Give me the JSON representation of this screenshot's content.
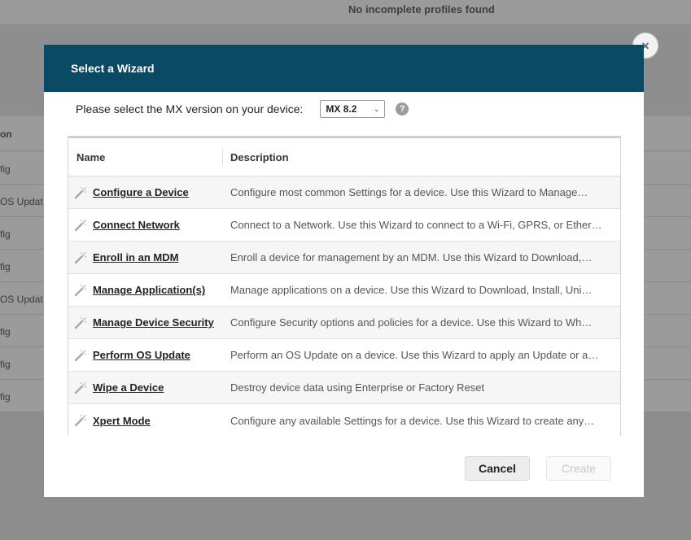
{
  "background": {
    "banner_text": "No incomplete profiles found",
    "column_header": "on",
    "rows": [
      "fig",
      "OS Updat",
      "fig",
      "fig",
      "OS Updat",
      "fig",
      "fig",
      "fig"
    ]
  },
  "dialog": {
    "title": "Select a Wizard",
    "close_symbol": "×",
    "mx_label": "Please select the MX version on your device:",
    "mx_selected": "MX 8.2",
    "help_symbol": "?",
    "columns": {
      "name": "Name",
      "description": "Description"
    },
    "wizards": [
      {
        "name": "Configure a Device",
        "description": "Configure most common Settings for a device. Use this Wizard to Manage…"
      },
      {
        "name": "Connect Network",
        "description": "Connect to a Network. Use this Wizard to connect to a Wi-Fi, GPRS, or Ether…"
      },
      {
        "name": "Enroll in an MDM",
        "description": "Enroll a device for management by an MDM.  Use this Wizard to Download,…"
      },
      {
        "name": "Manage Application(s)",
        "description": "Manage applications on a device.  Use this Wizard to Download, Install, Uni…"
      },
      {
        "name": "Manage Device Security",
        "description": "Configure Security options and policies for a device.  Use this Wizard to Wh…"
      },
      {
        "name": "Perform OS Update",
        "description": "Perform an OS Update on a device.  Use this Wizard to apply an Update or a…"
      },
      {
        "name": "Wipe a Device",
        "description": "Destroy device data using Enterprise or Factory Reset"
      },
      {
        "name": "Xpert Mode",
        "description": "Configure any available Settings for a device. Use this Wizard to create any…"
      }
    ],
    "cancel_label": "Cancel",
    "create_label": "Create"
  },
  "colors": {
    "header_bg": "#0b4a64",
    "overlay": "#8d8d8d"
  }
}
